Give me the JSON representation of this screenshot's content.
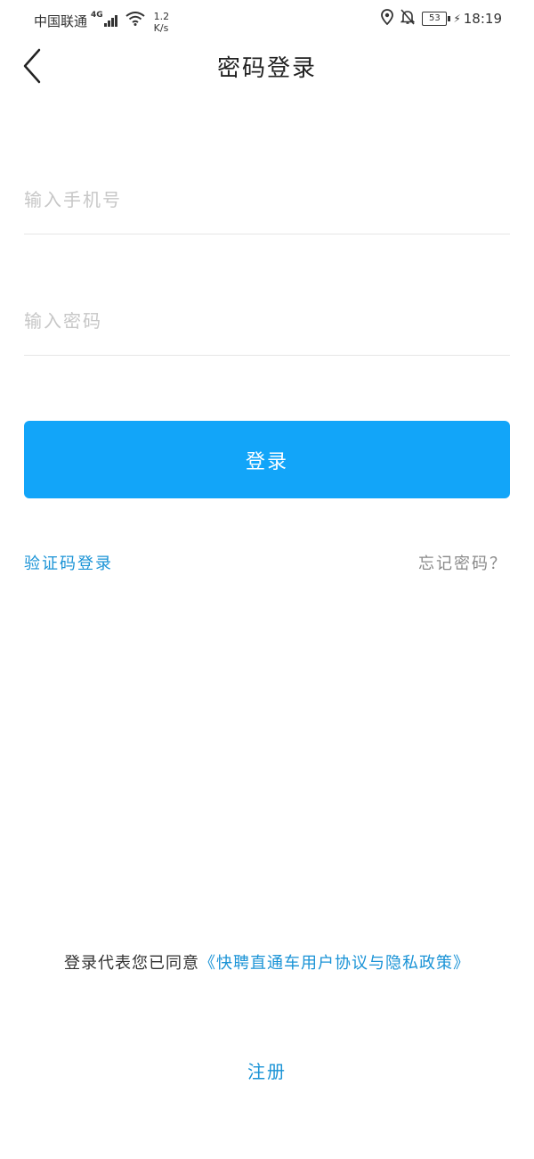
{
  "status_bar": {
    "carrier": "中国联通",
    "network_type": "4G",
    "speed_value": "1.2",
    "speed_unit": "K/s",
    "battery": "53",
    "time": "18:19"
  },
  "header": {
    "title": "密码登录"
  },
  "form": {
    "phone_placeholder": "输入手机号",
    "password_placeholder": "输入密码",
    "login_label": "登录"
  },
  "links": {
    "sms_login": "验证码登录",
    "forgot_password": "忘记密码？"
  },
  "agreement": {
    "prefix": "登录代表您已同意",
    "policy_link": "《快聘直通车用户协议与隐私政策》"
  },
  "register": {
    "label": "注册"
  },
  "colors": {
    "primary": "#12a5f9",
    "link": "#1a93d6",
    "muted": "#8a8a8a"
  }
}
